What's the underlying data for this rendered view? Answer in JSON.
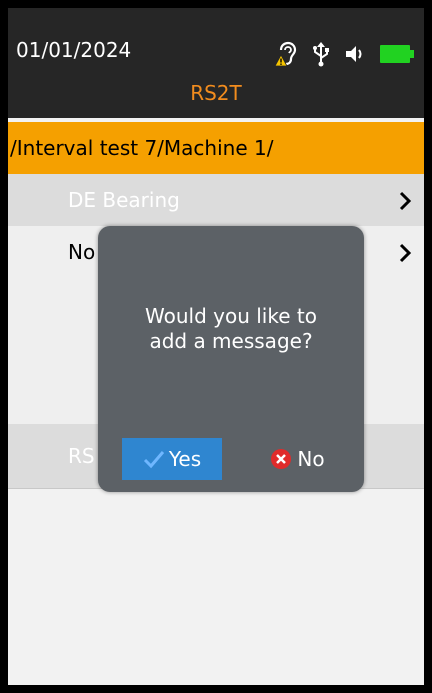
{
  "status_bar": {
    "date": "01/01/2024",
    "device_name": "RS2T",
    "icons": [
      "ear-warning-icon",
      "usb-icon",
      "speaker-icon",
      "battery-icon"
    ],
    "device_color": "#f28c1e",
    "battery_color": "#21d221"
  },
  "path_bar": {
    "path": "/Interval test 7/Machine 1/",
    "color": "#f5a000"
  },
  "list": {
    "items": [
      {
        "label": "DE Bearing"
      },
      {
        "label": "No"
      },
      {
        "label": ""
      },
      {
        "label": "RS"
      }
    ]
  },
  "dialog": {
    "message_line1": "Would you like to",
    "message_line2": "add a message?",
    "yes_label": "Yes",
    "no_label": "No",
    "yes_color": "#2f86d0",
    "no_icon_color": "#e02b2b"
  }
}
